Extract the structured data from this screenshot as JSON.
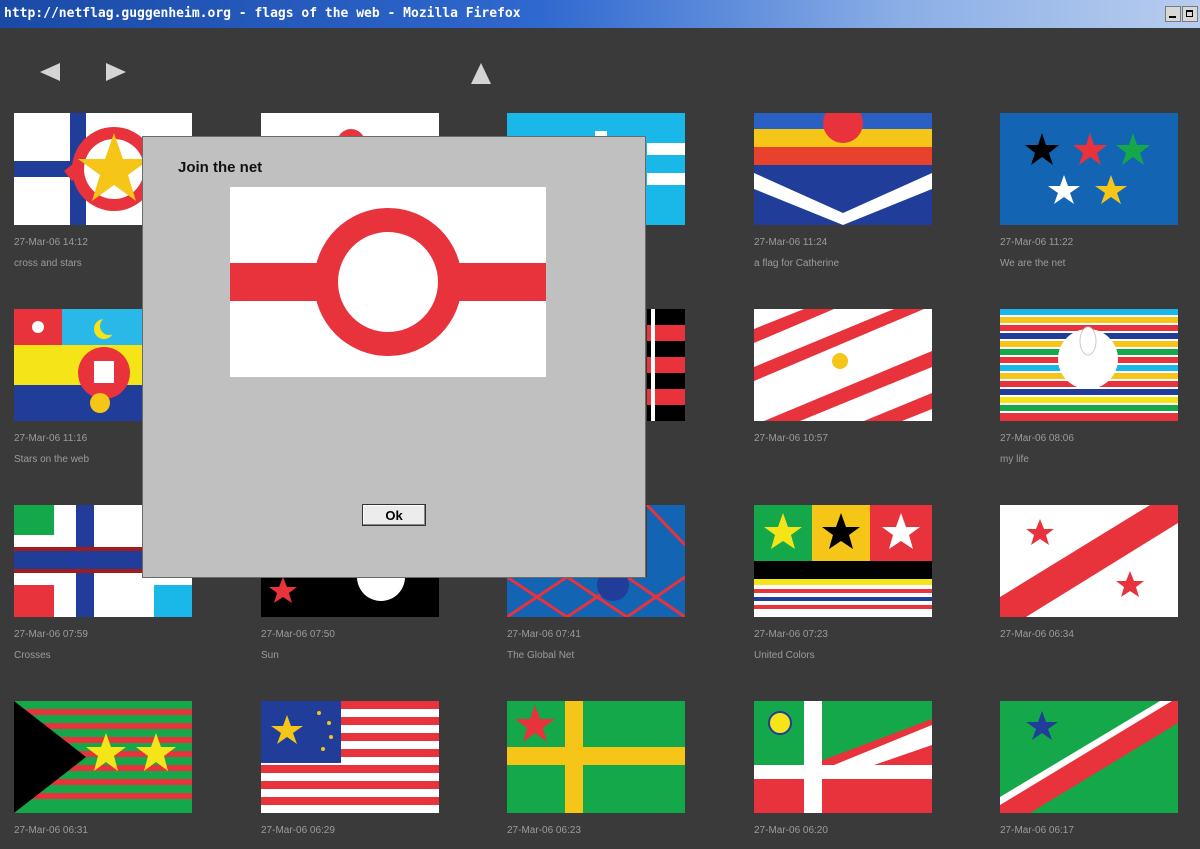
{
  "window": {
    "title": "http://netflag.guggenheim.org - flags of the web - Mozilla Firefox",
    "controls": [
      "minimize-icon",
      "maximize-icon"
    ]
  },
  "nav": {
    "prev_icon": "triangle-left-icon",
    "next_icon": "triangle-right-icon",
    "up_icon": "triangle-up-icon"
  },
  "colors": {
    "background": "#3a3a3a",
    "caption": "#9c9c9c",
    "dialog": "#c0c0c0",
    "flag_red": "#e8323c",
    "flag_blue": "#1f3d99",
    "flag_yellow": "#f5c518",
    "flag_green": "#15a84a",
    "flag_sky": "#1ab8e8"
  },
  "flags": [
    {
      "date": "27-Mar-06 14:12",
      "label": "cross and stars"
    },
    {
      "date": "",
      "label": ""
    },
    {
      "date": "",
      "label": ""
    },
    {
      "date": "27-Mar-06 11:24",
      "label": "a flag for Catherine"
    },
    {
      "date": "27-Mar-06 11:22",
      "label": "We are the net"
    },
    {
      "date": "27-Mar-06 11:16",
      "label": "Stars on the web"
    },
    {
      "date": "",
      "label": ""
    },
    {
      "date": "",
      "label": ""
    },
    {
      "date": "27-Mar-06 10:57",
      "label": ""
    },
    {
      "date": "27-Mar-06 08:06",
      "label": "my life"
    },
    {
      "date": "27-Mar-06 07:59",
      "label": "Crosses"
    },
    {
      "date": "27-Mar-06 07:50",
      "label": "Sun"
    },
    {
      "date": "27-Mar-06 07:41",
      "label": "The Global Net"
    },
    {
      "date": "27-Mar-06 07:23",
      "label": "United Colors"
    },
    {
      "date": "27-Mar-06 06:34",
      "label": ""
    },
    {
      "date": "27-Mar-06 06:31",
      "label": ""
    },
    {
      "date": "27-Mar-06 06:29",
      "label": ""
    },
    {
      "date": "27-Mar-06 06:23",
      "label": ""
    },
    {
      "date": "27-Mar-06 06:20",
      "label": ""
    },
    {
      "date": "27-Mar-06 06:17",
      "label": ""
    }
  ],
  "dialog": {
    "title": "Join the net",
    "ok_label": "Ok"
  }
}
